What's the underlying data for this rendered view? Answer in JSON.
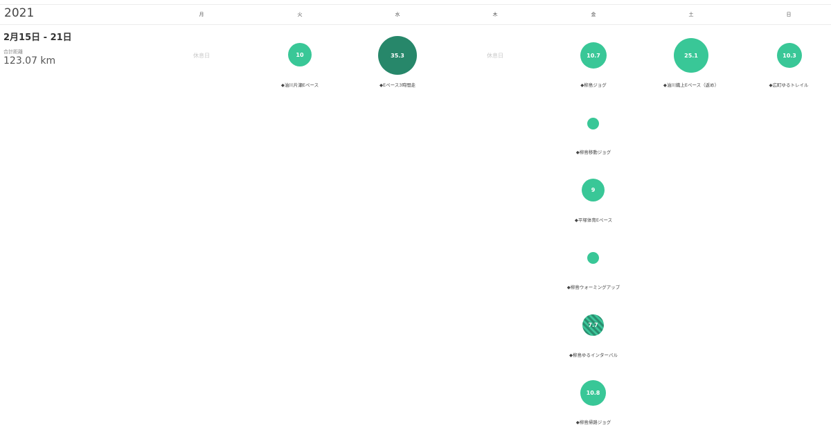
{
  "year": "2021",
  "days": [
    "月",
    "火",
    "水",
    "木",
    "金",
    "土",
    "日"
  ],
  "week": {
    "title": "2月15日 - 21日",
    "distance_label": "合計距離",
    "distance_value": "123.07 km",
    "rest_label": "休息日"
  },
  "activities": [
    {
      "day": "火",
      "value": "10",
      "name": "◆油川片瀬Eペース",
      "style": "normal"
    },
    {
      "day": "水",
      "value": "35.3",
      "name": "◆Eペース3時間走",
      "style": "dark"
    },
    {
      "day": "金",
      "value": "10.7",
      "name": "◆柳島ジョグ",
      "style": "normal"
    },
    {
      "day": "土",
      "value": "25.1",
      "name": "◆油川織上Eペース（返め）",
      "style": "normal"
    },
    {
      "day": "日",
      "value": "10.3",
      "name": "◆広町ゆるトレイル",
      "style": "normal"
    },
    {
      "day": "金",
      "value": "",
      "name": "◆柳島移動ジョグ",
      "style": "normal"
    },
    {
      "day": "金",
      "value": "9",
      "name": "◆平塚体育Eペース",
      "style": "normal"
    },
    {
      "day": "金",
      "value": "",
      "name": "◆柳島ウォーミングアップ",
      "style": "normal"
    },
    {
      "day": "金",
      "value": "7.7",
      "name": "◆柳島ゆるインターバル",
      "style": "striped"
    },
    {
      "day": "金",
      "value": "10.8",
      "name": "◆柳島帰路ジョグ",
      "style": "normal"
    }
  ],
  "colors": {
    "accent": "#39c797",
    "dark": "#27876a",
    "rest": "#c8c8c8"
  }
}
